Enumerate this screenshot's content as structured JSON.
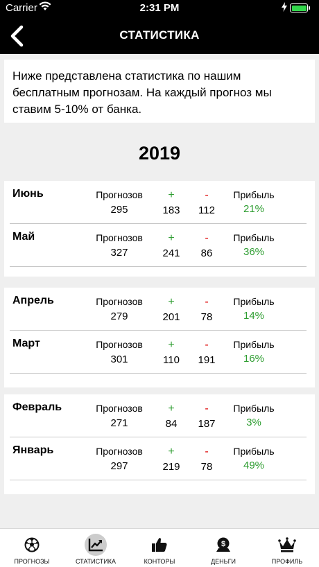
{
  "status": {
    "carrier": "Carrier",
    "time": "2:31 PM"
  },
  "nav": {
    "title": "СТАТИСТИКА"
  },
  "intro": "Ниже представлена статистика по нашим бесплатным прогнозам. На каждый прогноз мы ставим 5-10% от банка.",
  "year": "2019",
  "labels": {
    "forecasts": "Прогнозов",
    "plus": "+",
    "minus": "-",
    "profit": "Прибыль"
  },
  "months": [
    {
      "name": "Июнь",
      "forecasts": "295",
      "plus": "183",
      "minus": "112",
      "profit": "21%"
    },
    {
      "name": "Май",
      "forecasts": "327",
      "plus": "241",
      "minus": "86",
      "profit": "36%"
    },
    {
      "name": "Апрель",
      "forecasts": "279",
      "plus": "201",
      "minus": "78",
      "profit": "14%"
    },
    {
      "name": "Март",
      "forecasts": "301",
      "plus": "110",
      "minus": "191",
      "profit": "16%"
    },
    {
      "name": "Февраль",
      "forecasts": "271",
      "plus": "84",
      "minus": "187",
      "profit": "3%"
    },
    {
      "name": "Январь",
      "forecasts": "297",
      "plus": "219",
      "minus": "78",
      "profit": "49%"
    }
  ],
  "tabs": [
    {
      "label": "ПРОГНОЗЫ",
      "icon": "soccer-ball-icon"
    },
    {
      "label": "СТАТИСТИКА",
      "icon": "chart-icon",
      "active": true
    },
    {
      "label": "КОНТОРЫ",
      "icon": "thumbs-up-icon"
    },
    {
      "label": "ДЕНЬГИ",
      "icon": "money-bag-icon"
    },
    {
      "label": "ПРОФИЛЬ",
      "icon": "crown-icon"
    }
  ],
  "colors": {
    "positive": "#2e9d31",
    "negative": "#dd0000",
    "battery": "#32d74b"
  }
}
